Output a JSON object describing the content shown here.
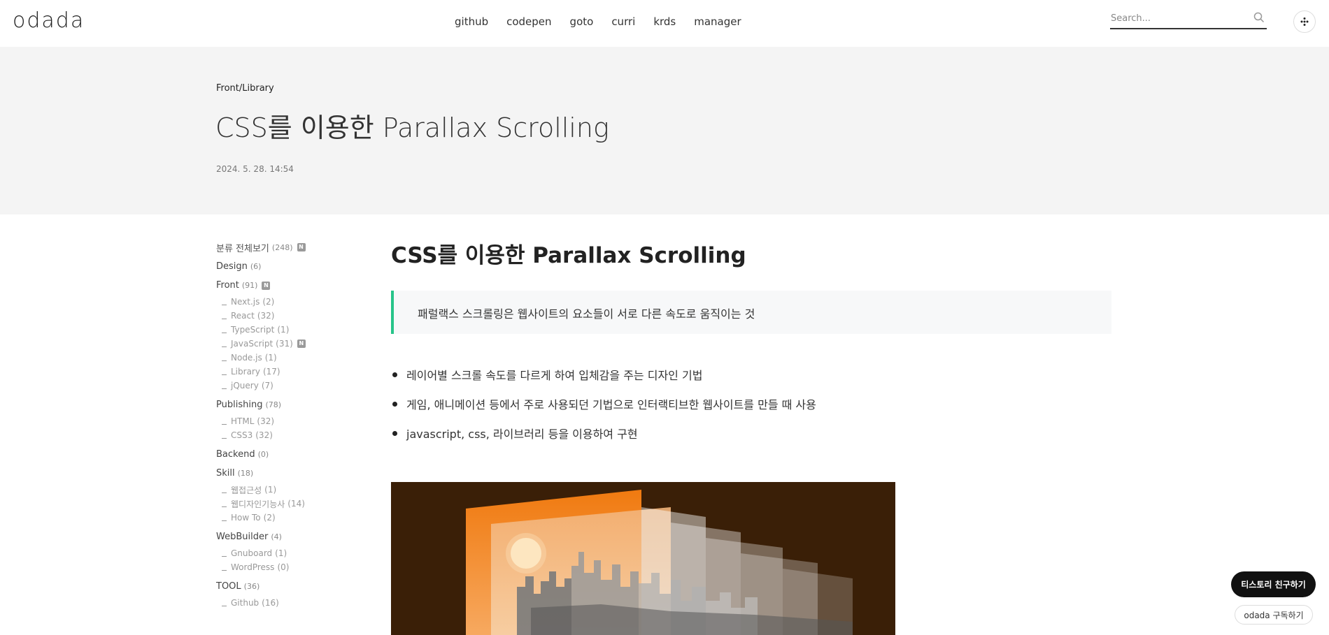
{
  "header": {
    "logo": "odada",
    "nav": [
      "github",
      "codepen",
      "goto",
      "curri",
      "krds",
      "manager"
    ],
    "search_placeholder": "Search...",
    "search_icon": "search-icon",
    "menu_icon": "more-dots-icon"
  },
  "post": {
    "category": "Front/Library",
    "title": "CSS를 이용한 Parallax Scrolling",
    "date": "2024. 5. 28. 14:54"
  },
  "sidebar": {
    "all": {
      "label": "분류 전체보기",
      "count": "(248)"
    },
    "new_badge": "N",
    "categories": [
      {
        "label": "Design",
        "count": "(6)",
        "items": []
      },
      {
        "label": "Front",
        "count": "(91)",
        "items": [
          {
            "label": "Next.js",
            "count": "(2)"
          },
          {
            "label": "React",
            "count": "(32)"
          },
          {
            "label": "TypeScript",
            "count": "(1)"
          },
          {
            "label": "JavaScript",
            "count": "(31)"
          },
          {
            "label": "Node.js",
            "count": "(1)"
          },
          {
            "label": "Library",
            "count": "(17)"
          },
          {
            "label": "jQuery",
            "count": "(7)"
          }
        ]
      },
      {
        "label": "Publishing",
        "count": "(78)",
        "items": [
          {
            "label": "HTML",
            "count": "(32)"
          },
          {
            "label": "CSS3",
            "count": "(32)"
          }
        ]
      },
      {
        "label": "Backend",
        "count": "(0)",
        "items": []
      },
      {
        "label": "Skill",
        "count": "(18)",
        "items": [
          {
            "label": "웹접근성",
            "count": "(1)"
          },
          {
            "label": "웹디자인기능사",
            "count": "(14)"
          },
          {
            "label": "How To",
            "count": "(2)"
          }
        ]
      },
      {
        "label": "WebBuilder",
        "count": "(4)",
        "items": [
          {
            "label": "Gnuboard",
            "count": "(1)"
          },
          {
            "label": "WordPress",
            "count": "(0)"
          }
        ]
      },
      {
        "label": "TOOL",
        "count": "(36)",
        "items": [
          {
            "label": "Github",
            "count": "(16)"
          }
        ]
      }
    ]
  },
  "article": {
    "heading": "CSS를 이용한 Parallax Scrolling",
    "quote": "패럴랙스 스크롤링은 웹사이트의 요소들이 서로 다른 속도로 움직이는 것",
    "bullets": [
      "레이어별 스크롤 속도를 다르게 하여 입체감을 주는 디자인 기법",
      "게임, 애니메이션 등에서 주로 사용되던 기법으로 인터랙티브한 웹사이트를 만들 때 사용",
      "javascript, css, 라이브러리 등을 이용하여 구현"
    ]
  },
  "floating": {
    "friend": "티스토리 친구하기",
    "subscribe": "odada 구독하기"
  },
  "colors": {
    "accent": "#27c48a",
    "hero_bg": "#f4f4f4",
    "figure_bg": "#3a1f07"
  }
}
